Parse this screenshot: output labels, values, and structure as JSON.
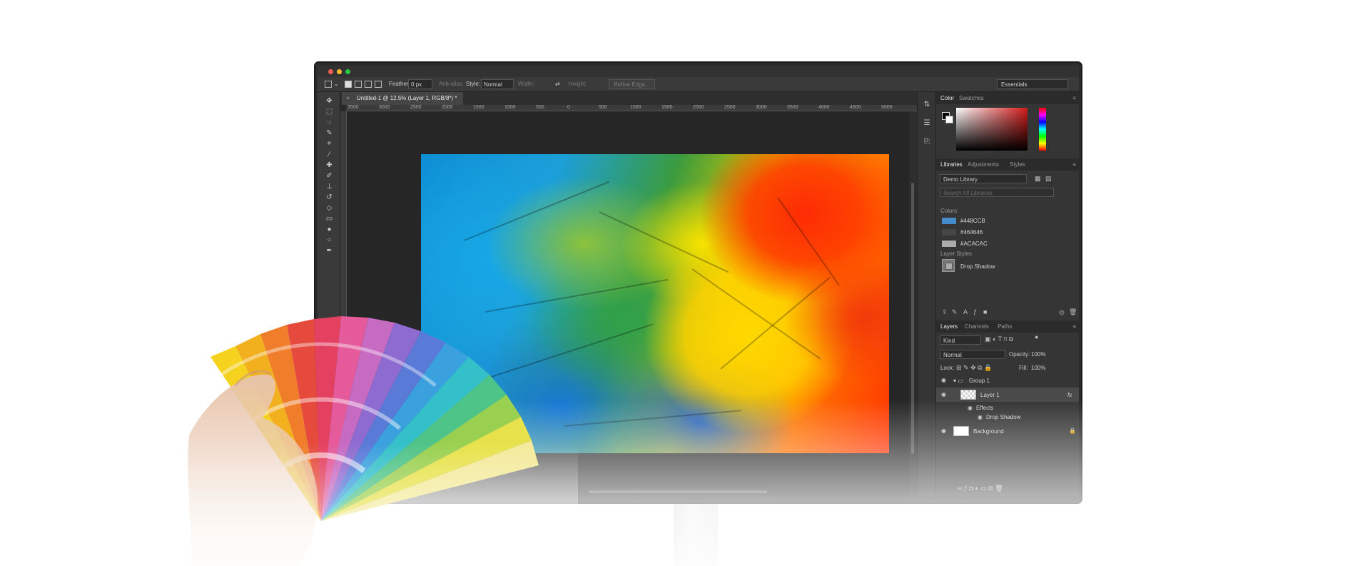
{
  "window": {
    "document_tab": "Untitled-1 @ 12.5% (Layer 1, RGB/8*) *",
    "tab_close": "×"
  },
  "options_bar": {
    "feather_label": "Feather:",
    "feather_value": "0 px",
    "antialias_label": "Anti-alias",
    "style_label": "Style:",
    "style_value": "Normal",
    "width_label": "Width:",
    "height_label": "Height:",
    "refine_edge": "Refine Edge...",
    "workspace": "Essentials"
  },
  "ruler": {
    "ticks": [
      "3500",
      "3000",
      "2500",
      "2000",
      "1500",
      "1000",
      "500",
      "0",
      "500",
      "1000",
      "1500",
      "2000",
      "2500",
      "3000",
      "3500",
      "4000",
      "4500",
      "5000"
    ]
  },
  "color_panel": {
    "tabs": [
      "Color",
      "Swatches"
    ],
    "active_tab": "Color"
  },
  "libraries_panel": {
    "tabs": [
      "Libraries",
      "Adjustments",
      "Styles"
    ],
    "library_name": "Demo Library",
    "search_placeholder": "Search All Libraries",
    "colors_heading": "Colors",
    "colors": [
      {
        "hex": "#448CCB",
        "label": "#448CCB"
      },
      {
        "hex": "#464646",
        "label": "#464646"
      },
      {
        "hex": "#ACACAC",
        "label": "#ACACAC"
      }
    ],
    "layer_styles_heading": "Layer Styles",
    "layer_style_item": "Drop Shadow"
  },
  "layers_panel": {
    "tabs": [
      "Layers",
      "Channels",
      "Paths"
    ],
    "filter_kind": "Kind",
    "blend_mode": "Normal",
    "opacity_label": "Opacity:",
    "opacity_value": "100%",
    "lock_label": "Lock:",
    "fill_label": "Fill:",
    "fill_value": "100%",
    "group_name": "Group 1",
    "layer_name": "Layer 1",
    "fx": "fx",
    "effects_label": "Effects",
    "drop_shadow_label": "Drop Shadow",
    "background_name": "Background"
  }
}
